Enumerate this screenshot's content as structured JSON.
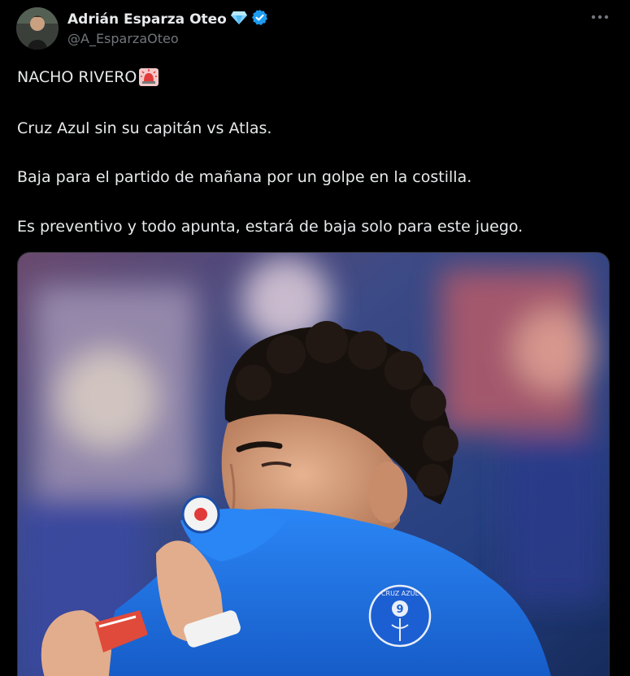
{
  "author": {
    "name": "Adrián Esparza Oteo",
    "handle": "@A_EsparzaOteo",
    "badges": [
      "diamond-icon",
      "verified-badge-icon"
    ]
  },
  "tweet": {
    "lines": [
      "NACHO RIVERO",
      "Cruz Azul sin su capitán vs Atlas.",
      "Baja para el partido de mañana por un golpe en la costilla.",
      "Es preventivo y todo apunta, estará de baja solo para este juego."
    ],
    "title_emoji": "siren-icon"
  },
  "media": {
    "description_icon": "player-photo",
    "crest_text": "CRUZ AZUL",
    "crest_number": "9"
  },
  "colors": {
    "background": "#000000",
    "text": "#e7e9ea",
    "muted": "#71767b",
    "verified": "#1d9bf0",
    "jersey": "#1f6fe0"
  }
}
